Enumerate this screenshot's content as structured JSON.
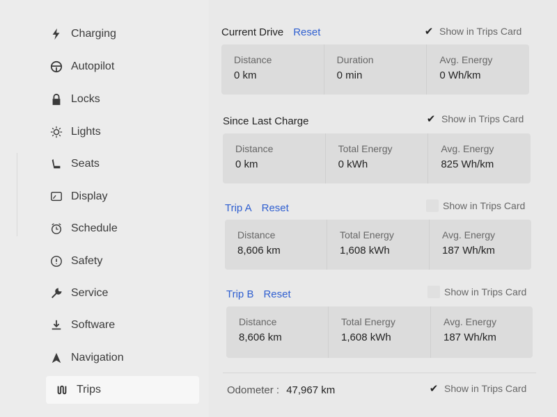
{
  "sidebar": {
    "items": [
      {
        "label": "Charging",
        "icon": "lightning-icon"
      },
      {
        "label": "Autopilot",
        "icon": "steering-wheel-icon"
      },
      {
        "label": "Locks",
        "icon": "lock-icon"
      },
      {
        "label": "Lights",
        "icon": "sun-icon"
      },
      {
        "label": "Seats",
        "icon": "seat-icon"
      },
      {
        "label": "Display",
        "icon": "display-icon"
      },
      {
        "label": "Schedule",
        "icon": "clock-icon"
      },
      {
        "label": "Safety",
        "icon": "info-circle-icon"
      },
      {
        "label": "Service",
        "icon": "wrench-icon"
      },
      {
        "label": "Software",
        "icon": "download-icon"
      },
      {
        "label": "Navigation",
        "icon": "navigation-arrow-icon"
      },
      {
        "label": "Trips",
        "icon": "trips-icon"
      }
    ],
    "active": "Trips"
  },
  "current_drive": {
    "title": "Current Drive",
    "reset": "Reset",
    "show_in_trips_card": "Show in Trips Card",
    "checked": true,
    "stats": [
      {
        "label": "Distance",
        "value": "0 km"
      },
      {
        "label": "Duration",
        "value": "0 min"
      },
      {
        "label": "Avg. Energy",
        "value": "0 Wh/km"
      }
    ]
  },
  "since_last_charge": {
    "title": "Since Last Charge",
    "show_in_trips_card": "Show in Trips Card",
    "checked": true,
    "stats": [
      {
        "label": "Distance",
        "value": "0 km"
      },
      {
        "label": "Total Energy",
        "value": "0 kWh"
      },
      {
        "label": "Avg. Energy",
        "value": "825 Wh/km"
      }
    ]
  },
  "trip_a": {
    "title": "Trip A",
    "reset": "Reset",
    "show_in_trips_card": "Show in Trips Card",
    "checked": false,
    "stats": [
      {
        "label": "Distance",
        "value": "8,606 km"
      },
      {
        "label": "Total Energy",
        "value": "1,608 kWh"
      },
      {
        "label": "Avg. Energy",
        "value": "187 Wh/km"
      }
    ]
  },
  "trip_b": {
    "title": "Trip B",
    "reset": "Reset",
    "show_in_trips_card": "Show in Trips Card",
    "checked": false,
    "stats": [
      {
        "label": "Distance",
        "value": "8,606 km"
      },
      {
        "label": "Total Energy",
        "value": "1,608 kWh"
      },
      {
        "label": "Avg. Energy",
        "value": "187 Wh/km"
      }
    ]
  },
  "odometer": {
    "label": "Odometer :",
    "value": "47,967 km",
    "show_in_trips_card": "Show in Trips Card",
    "checked": true
  },
  "colors": {
    "accent": "#2f5fd0",
    "background": "#e9e9e9",
    "card": "#dcdcdc"
  }
}
